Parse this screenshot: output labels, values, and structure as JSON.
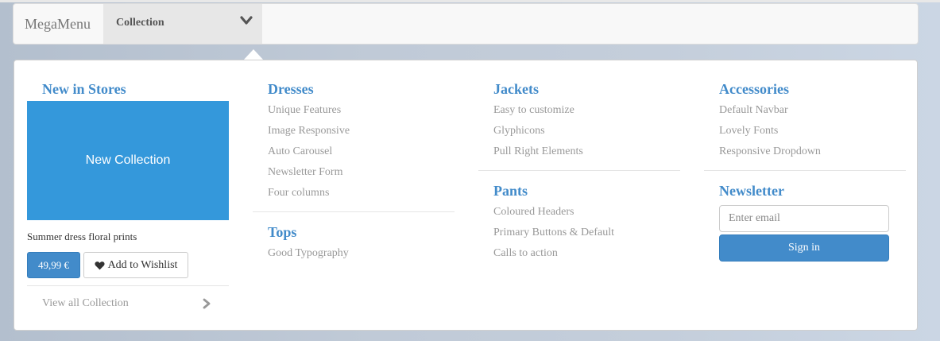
{
  "navbar": {
    "brand": "MegaMenu",
    "dropdown_label": "Collection",
    "dropdown_icon": "chevron-down-icon"
  },
  "promo": {
    "heading": "New in Stores",
    "banner_text": "New Collection",
    "caption": "Summer dress floral prints",
    "price": "49,99 €",
    "wishlist_label": "Add to Wishlist",
    "wishlist_icon": "heart-icon",
    "view_all": "View all Collection",
    "view_all_icon": "chevron-right-icon",
    "banner_color": "#3498db"
  },
  "columns": {
    "dresses": {
      "heading": "Dresses",
      "links": [
        "Unique Features",
        "Image Responsive",
        "Auto Carousel",
        "Newsletter Form",
        "Four columns"
      ]
    },
    "tops": {
      "heading": "Tops",
      "links": [
        "Good Typography"
      ]
    },
    "jackets": {
      "heading": "Jackets",
      "links": [
        "Easy to customize",
        "Glyphicons",
        "Pull Right Elements"
      ]
    },
    "pants": {
      "heading": "Pants",
      "links": [
        "Coloured Headers",
        "Primary Buttons & Default",
        "Calls to action"
      ]
    },
    "accessories": {
      "heading": "Accessories",
      "links": [
        "Default Navbar",
        "Lovely Fonts",
        "Responsive Dropdown"
      ]
    }
  },
  "newsletter": {
    "heading": "Newsletter",
    "email_placeholder": "Enter email",
    "signin_label": "Sign in"
  },
  "colors": {
    "accent": "#428bca",
    "link": "#999999"
  }
}
